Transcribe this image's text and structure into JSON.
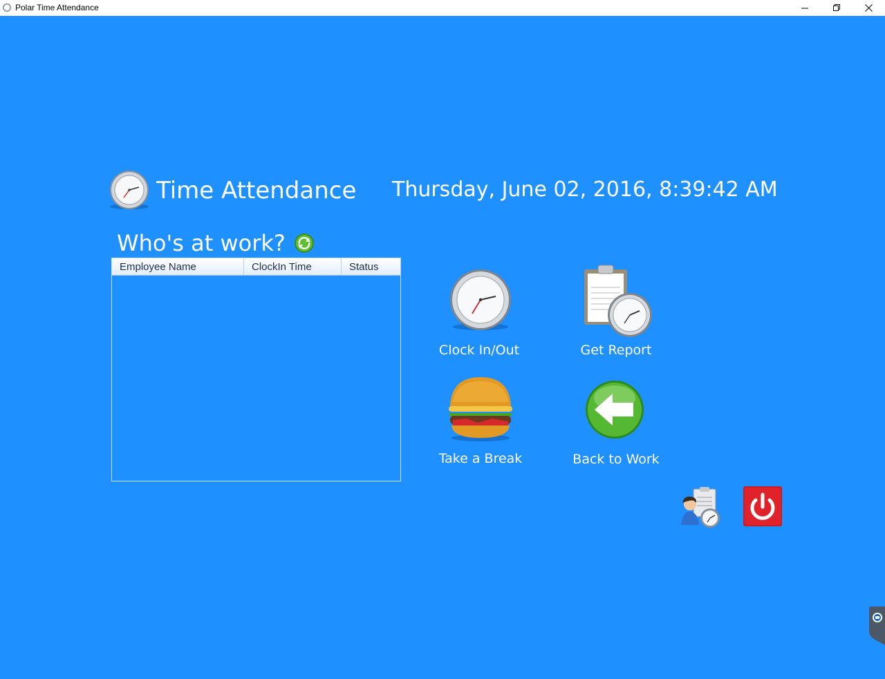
{
  "window": {
    "title": "Polar Time Attendance",
    "controls": [
      "minimize",
      "restore",
      "close"
    ]
  },
  "header": {
    "app_title": "Time Attendance",
    "datetime": "Thursday, June 02, 2016, 8:39:42 AM"
  },
  "who_at_work": {
    "title": "Who's at work?",
    "columns": [
      "Employee Name",
      "ClockIn Time",
      "Status"
    ],
    "rows": []
  },
  "actions": {
    "clock_in_out": "Clock In/Out",
    "get_report": "Get Report",
    "take_break": "Take a Break",
    "back_to_work": "Back to Work"
  },
  "icons": {
    "header": "clock-icon",
    "refresh": "refresh-icon",
    "clock_in_out": "clock-icon",
    "get_report": "timesheet-clock-icon",
    "take_break": "burger-icon",
    "back_to_work": "green-back-arrow-icon",
    "admin": "user-timesheet-icon",
    "power": "power-icon"
  },
  "colors": {
    "background": "#1e90ff",
    "text": "#ffffff",
    "power_button": "#e0232a",
    "back_arrow": "#4caf2a"
  }
}
